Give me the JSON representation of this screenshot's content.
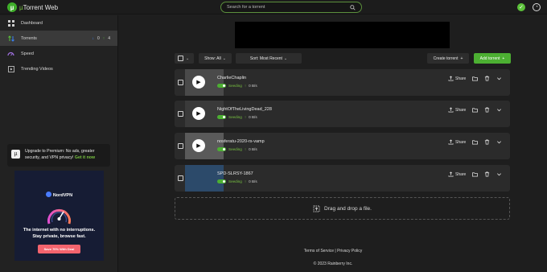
{
  "brand": {
    "logo_letter": "µ",
    "name_mu": "µ",
    "name_rest": "Torrent Web"
  },
  "search": {
    "placeholder": "Search for a torrent"
  },
  "sidebar": {
    "items": [
      {
        "label": "Dashboard",
        "icon": "grid-icon"
      },
      {
        "label": "Torrents",
        "icon": "transfer-icon",
        "down": "0",
        "up": "4"
      },
      {
        "label": "Speed",
        "icon": "speed-icon"
      },
      {
        "label": "Trending Videos",
        "icon": "video-icon"
      }
    ],
    "premium": {
      "text": "Upgrade to Premium: No ads, greater security, and VPN privacy!",
      "link": "Get it now"
    }
  },
  "ad": {
    "brand": "NordVPN",
    "headline_1": "The internet with no interruptions.",
    "headline_2": "Stay private, browse fast.",
    "cta": "Save 70% With Deal"
  },
  "toolbar": {
    "show_label": "Show: All",
    "sort_label": "Sort: Most Recent",
    "create_label": "Create torrent",
    "add_label": "Add torrent"
  },
  "torrents": [
    {
      "name": "CharlieChaplin",
      "status": "Seeding",
      "rate": "0 B/s",
      "thumb_color": "#4a4a4a"
    },
    {
      "name": "NightOfTheLivingDead_228",
      "status": "Seeding",
      "rate": "0 B/s",
      "thumb_color": "#3a3a3a"
    },
    {
      "name": "nosferatu-2020-rs-vamp",
      "status": "Seeding",
      "rate": "0 B/s",
      "thumb_color": "#5a5a5a"
    },
    {
      "name": "SPD-SLRSY-1867",
      "status": "Seeding",
      "rate": "0 B/s",
      "thumb_color": "#2c4a6a"
    }
  ],
  "row_actions": {
    "share": "Share"
  },
  "drop_zone": {
    "text": "Drag and drop a file."
  },
  "footer": {
    "terms": "Terms of Service",
    "sep": "|",
    "privacy": "Privacy Policy",
    "copyright": "© 2023 Rainberry Inc."
  },
  "colors": {
    "accent": "#4caf32",
    "accent_text": "#78c341",
    "download": "#3b82f6"
  }
}
